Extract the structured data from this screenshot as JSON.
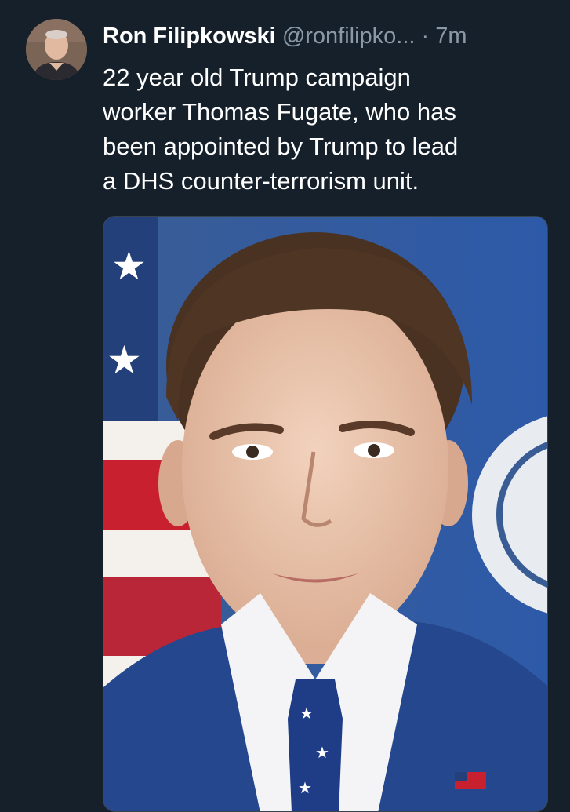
{
  "tweet": {
    "author": {
      "display_name": "Ron Filipkowski",
      "handle": "@ronfilipko...",
      "avatar_icon": "person-avatar"
    },
    "separator": "·",
    "timestamp": "7m",
    "text": "22 year old Trump campaign\nworker Thomas Fugate, who has\nbeen appointed by Trump to lead\na DHS counter-terrorism unit.",
    "media": {
      "type": "photo",
      "alt_icon": "portrait-photo"
    }
  },
  "colors": {
    "background": "#15202b",
    "primary_text": "#ffffff",
    "secondary_text": "#8b98a5",
    "media_border": "#38444d"
  }
}
